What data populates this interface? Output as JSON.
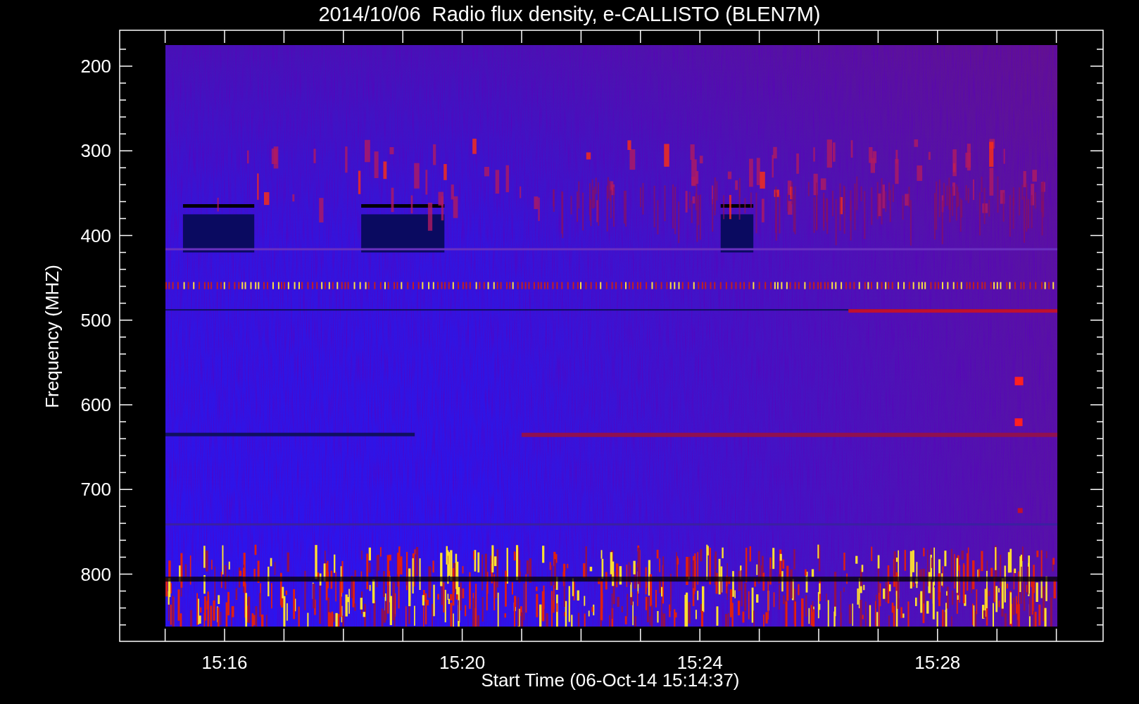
{
  "title": "2014/10/06  Radio flux density, e-CALLISTO (BLEN7M)",
  "y_axis": {
    "label": "Frequency (MHZ)",
    "ticks": [
      "200",
      "300",
      "400",
      "500",
      "600",
      "700",
      "800"
    ]
  },
  "x_axis": {
    "label": "Start Time (06-Oct-14 15:14:37)",
    "ticks": [
      "15:16",
      "15:20",
      "15:24",
      "15:28"
    ]
  }
}
